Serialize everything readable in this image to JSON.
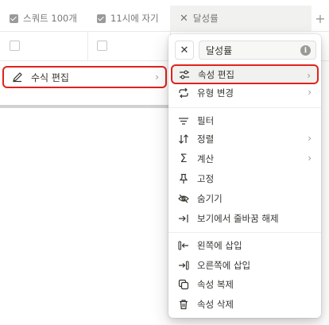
{
  "header": {
    "col1_label": "스쿼트 100개",
    "col2_label": "11시에 자기",
    "col3_label": "달성률",
    "add_symbol": "+"
  },
  "left_menu": {
    "formula_edit_label": "수식 편집"
  },
  "menu": {
    "property_name": "달성률",
    "items": [
      {
        "label": "속성 편집",
        "icon": "sliders-icon",
        "submenu": true
      },
      {
        "label": "유형 변경",
        "icon": "cycle-arrows-icon",
        "submenu": true
      },
      {
        "label": "필터",
        "icon": "filter-lines-icon",
        "submenu": false
      },
      {
        "label": "정렬",
        "icon": "sort-arrows-icon",
        "submenu": true
      },
      {
        "label": "계산",
        "icon": "sigma-icon",
        "submenu": true
      },
      {
        "label": "고정",
        "icon": "pin-icon",
        "submenu": false
      },
      {
        "label": "숨기기",
        "icon": "eye-off-icon",
        "submenu": false
      },
      {
        "label": "보기에서 줄바꿈 해제",
        "icon": "wrap-arrow-icon",
        "submenu": false
      },
      {
        "label": "왼쪽에 삽입",
        "icon": "insert-left-icon",
        "submenu": false
      },
      {
        "label": "오른쪽에 삽입",
        "icon": "insert-right-icon",
        "submenu": false
      },
      {
        "label": "속성 복제",
        "icon": "duplicate-icon",
        "submenu": false
      },
      {
        "label": "속성 삭제",
        "icon": "trash-icon",
        "submenu": false
      }
    ]
  },
  "colors": {
    "highlight": "#e0231c",
    "text": "#37352f",
    "muted": "#787774"
  }
}
